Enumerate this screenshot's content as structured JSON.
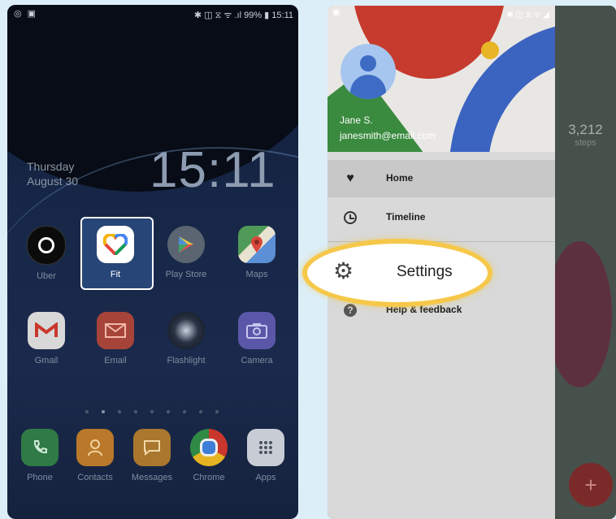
{
  "left_phone": {
    "status": {
      "left_icons": "◎ ▣",
      "right": "✱ ◫ ⧖ ᯤ .ıl 99% ▮ 15:11"
    },
    "date": {
      "day": "Thursday",
      "date": "August 30"
    },
    "clock": "15:11",
    "apps_row1": [
      {
        "label": "Uber",
        "icon": "uber-icon"
      },
      {
        "label": "Fit",
        "icon": "fit-heart-icon"
      },
      {
        "label": "Play Store",
        "icon": "play-store-icon"
      },
      {
        "label": "Maps",
        "icon": "maps-icon"
      }
    ],
    "apps_row2": [
      {
        "label": "Gmail",
        "icon": "gmail-icon"
      },
      {
        "label": "Email",
        "icon": "email-icon"
      },
      {
        "label": "Flashlight",
        "icon": "flashlight-icon"
      },
      {
        "label": "Camera",
        "icon": "camera-icon"
      }
    ],
    "dock": [
      {
        "label": "Phone",
        "icon": "phone-icon"
      },
      {
        "label": "Contacts",
        "icon": "contacts-icon"
      },
      {
        "label": "Messages",
        "icon": "messages-icon"
      },
      {
        "label": "Chrome",
        "icon": "chrome-icon"
      },
      {
        "label": "Apps",
        "icon": "apps-grid-icon"
      }
    ]
  },
  "right_phone": {
    "user": {
      "name": "Jane S.",
      "email": "janesmith@email.com"
    },
    "menu": [
      {
        "label": "Home",
        "icon": "heart-icon"
      },
      {
        "label": "Timeline",
        "icon": "clock-icon"
      },
      {
        "label": "Settings",
        "icon": "gear-icon"
      },
      {
        "label": "Help & feedback",
        "icon": "help-icon"
      }
    ],
    "background": {
      "steps_value": "3,212",
      "steps_label": "steps",
      "fab": "+"
    },
    "highlight_color": "#f6c84a"
  }
}
